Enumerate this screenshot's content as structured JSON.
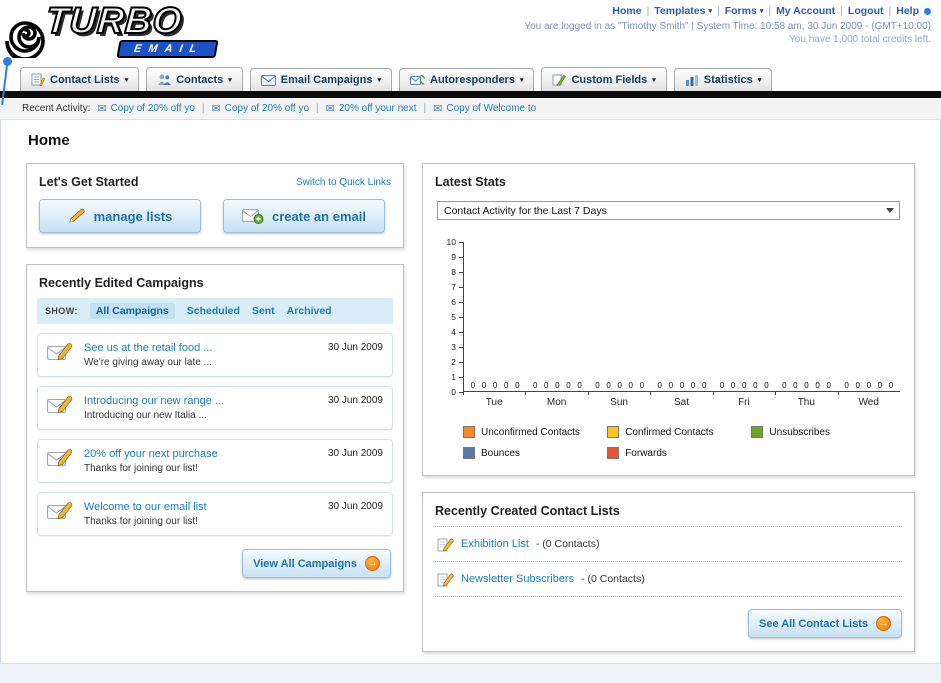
{
  "ui": {
    "sep": "|",
    "caret": "▾",
    "go_arrow": "→",
    "envelope_glyph": "✉"
  },
  "colors": {
    "accent_blue": "#1b7fb4",
    "nav_text": "#123f66",
    "black_bar": "#0c0c0c",
    "link_blue": "#2a5db0"
  },
  "header": {
    "logo_title": "TURBO",
    "logo_subtitle": "EMAIL",
    "links": [
      "Home",
      "Templates",
      "Forms",
      "My Account",
      "Logout",
      "Help"
    ],
    "login_line": "You are logged in as \"Timothy Smith\" | System Time: 10:58 am, 30 Jun 2009 - (GMT+10:00)",
    "credits_line": "You have 1,000 total credits left."
  },
  "nav": {
    "tabs": [
      {
        "label": "Contact Lists"
      },
      {
        "label": "Contacts"
      },
      {
        "label": "Email Campaigns"
      },
      {
        "label": "Autoresponders"
      },
      {
        "label": "Custom Fields"
      },
      {
        "label": "Statistics"
      }
    ]
  },
  "recent_activity": {
    "label": "Recent Activity:",
    "items": [
      "Copy of 20% off yo",
      "Copy of 20% off yo",
      "20% off your next",
      "Copy of Welcome to"
    ]
  },
  "page_title": "Home",
  "get_started": {
    "title": "Let's Get Started",
    "switch_link": "Switch to Quick Links",
    "manage_label": "manage lists",
    "create_label": "create an email"
  },
  "campaigns": {
    "title": "Recently Edited Campaigns",
    "show_label": "SHOW:",
    "filters": [
      "All Campaigns",
      "Scheduled",
      "Sent",
      "Archived"
    ],
    "active_filter": "All Campaigns",
    "items": [
      {
        "title": "See us at the retail food ...",
        "subtitle": "We're giving away our late ...",
        "date": "30 Jun 2009"
      },
      {
        "title": "Introducing our new range ...",
        "subtitle": "Introducing our new Italia ...",
        "date": "30 Jun 2009"
      },
      {
        "title": "20% off your next purchase",
        "subtitle": "Thanks for joining our list!",
        "date": "30 Jun 2009"
      },
      {
        "title": "Welcome to our email list",
        "subtitle": "Thanks for joining our list!",
        "date": "30 Jun 2009"
      }
    ],
    "view_all_label": "View All Campaigns"
  },
  "stats": {
    "title": "Latest Stats",
    "period": "Contact Activity for the Last 7 Days",
    "legend": [
      {
        "label": "Unconfirmed Contacts",
        "color": "#F6891F"
      },
      {
        "label": "Confirmed Contacts",
        "color": "#FDC41D"
      },
      {
        "label": "Unsubscribes",
        "color": "#69A622"
      },
      {
        "label": "Bounces",
        "color": "#5677A8"
      },
      {
        "label": "Forwards",
        "color": "#E5542D"
      }
    ]
  },
  "chart_data": {
    "type": "bar",
    "title": "Contact Activity for the Last 7 Days",
    "categories": [
      "Tue",
      "Mon",
      "Sun",
      "Sat",
      "Fri",
      "Thu",
      "Wed"
    ],
    "series": [
      {
        "name": "Unconfirmed Contacts",
        "values": [
          0,
          0,
          0,
          0,
          0,
          0,
          0
        ]
      },
      {
        "name": "Confirmed Contacts",
        "values": [
          0,
          0,
          0,
          0,
          0,
          0,
          0
        ]
      },
      {
        "name": "Unsubscribes",
        "values": [
          0,
          0,
          0,
          0,
          0,
          0,
          0
        ]
      },
      {
        "name": "Bounces",
        "values": [
          0,
          0,
          0,
          0,
          0,
          0,
          0
        ]
      },
      {
        "name": "Forwards",
        "values": [
          0,
          0,
          0,
          0,
          0,
          0,
          0
        ]
      }
    ],
    "ylim": [
      0,
      10
    ],
    "yticks": [
      0,
      1,
      2,
      3,
      4,
      5,
      6,
      7,
      8,
      9,
      10
    ],
    "grid": false,
    "legend_position": "bottom"
  },
  "contact_lists": {
    "title": "Recently Created Contact Lists",
    "items": [
      {
        "name": "Exhibition List",
        "detail": "- (0 Contacts)"
      },
      {
        "name": "Newsletter Subscribers",
        "detail": "- (0 Contacts)"
      }
    ],
    "see_all_label": "See All Contact Lists"
  }
}
